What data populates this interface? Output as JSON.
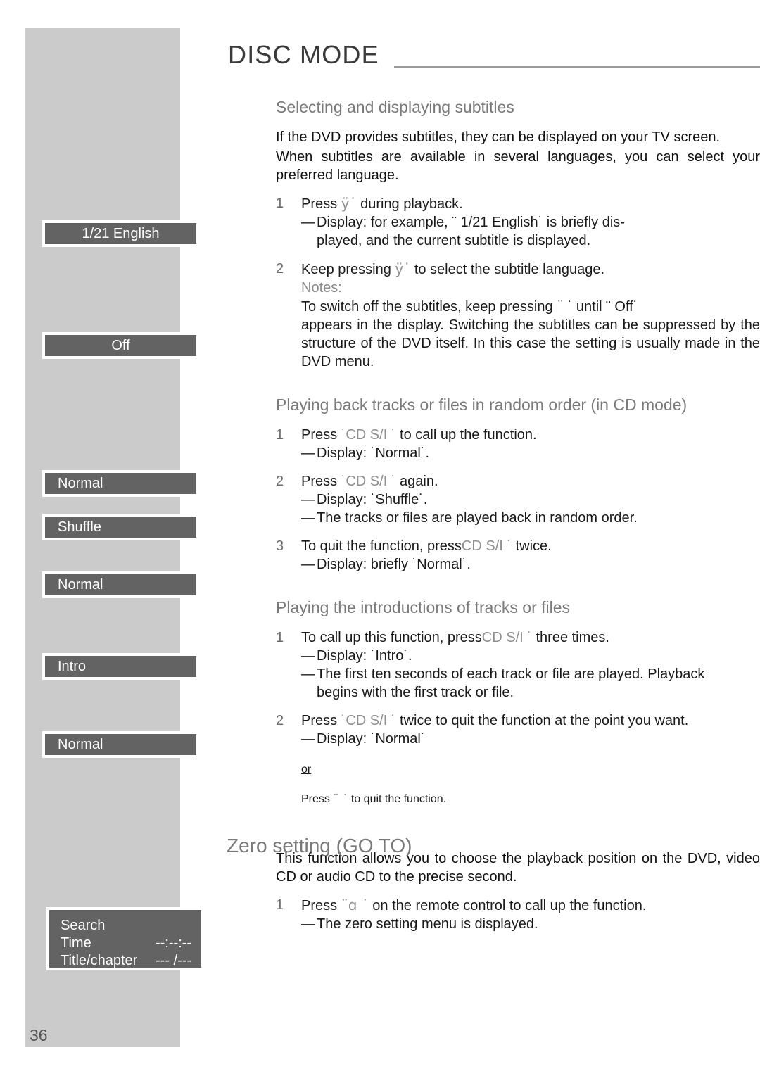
{
  "page": {
    "title": "DISC MODE",
    "number": "36"
  },
  "sidebar": {
    "boxes": [
      {
        "name": "subtitle-language",
        "label": "1/21  English"
      },
      {
        "name": "subtitle-off",
        "label": "Off"
      },
      {
        "name": "mode-normal-1",
        "label": "Normal"
      },
      {
        "name": "mode-shuffle",
        "label": "Shuffle"
      },
      {
        "name": "mode-normal-2",
        "label": "Normal"
      },
      {
        "name": "mode-intro",
        "label": "Intro"
      },
      {
        "name": "mode-normal-3",
        "label": "Normal"
      }
    ],
    "search_menu": {
      "title": "Search",
      "rows": [
        {
          "label": "Time",
          "value": "--:--:--"
        },
        {
          "label": "Title/chapter",
          "value": "--- /---"
        }
      ]
    }
  },
  "sections": {
    "subtitles": {
      "heading": "Selecting and displaying subtitles",
      "para1": "If the DVD provides subtitles, they can be displayed on your TV screen.",
      "para2": "When subtitles are available in several languages, you can select your preferred language.",
      "step1": {
        "num": "1",
        "line": "Press ÿ  ˙ during playback.",
        "press_prefix": "Press ",
        "key": "ÿ",
        "key_close": "˙",
        "suffix": " during playback.",
        "sub1_a": "Display:  for  example,  ¨     1/21  English˙  is  briefly  dis-",
        "sub1_b": "played, and the current subtitle is displayed."
      },
      "step2": {
        "num": "2",
        "press_prefix": "Keep pressing ",
        "key": "ÿ",
        "key_close": "˙",
        "suffix": " to select the subtitle language."
      },
      "notes_label": "Notes:",
      "notes_line1_a": "To switch off the subtitles, keep pressing ",
      "notes_line1_key": "¨",
      "notes_line1_b": " ˙ until ¨      Off˙",
      "notes_rest": "appears in the display. Switching the subtitles can be suppressed by the structure of the DVD itself. In this case the setting is usually made in the DVD menu."
    },
    "random": {
      "heading": "Playing back tracks or files in random order (in CD mode)",
      "step1": {
        "num": "1",
        "press_prefix": "Press ",
        "key": "˙CD S/I  ˙",
        "suffix": " to call up the function.",
        "sub": "Display: ˙Normal˙."
      },
      "step2": {
        "num": "2",
        "press_prefix": "Press ",
        "key": "˙CD S/I  ˙",
        "suffix": " again.",
        "sub1": "Display: ˙Shuffle˙.",
        "sub2": "The tracks or files are played back in random order."
      },
      "step3": {
        "num": "3",
        "press_prefix": "To quit the function, press",
        "key": "CD S/I  ˙",
        "suffix": " twice.",
        "sub": "Display: briefly ˙Normal˙."
      }
    },
    "intro": {
      "heading": "Playing the introductions of tracks or files",
      "step1": {
        "num": "1",
        "press_prefix": "To call up this function, press",
        "key": "CD S/I  ˙",
        "suffix": " three times.",
        "sub1": "Display: ˙Intro˙.",
        "sub2_a": "The first ten seconds of each track or file are played. Playback",
        "sub2_b": "begins with the first track or file."
      },
      "step2": {
        "num": "2",
        "press_prefix": "Press ",
        "key": "˙CD S/I  ˙",
        "suffix": " twice to quit the function at the point you want.",
        "sub": "Display: ˙Normal˙"
      },
      "or_word": "or",
      "quit_prefix": "Press ",
      "quit_key": "¨  ˙",
      "quit_suffix": " to quit the function."
    },
    "zero_setting": {
      "heading": "Zero setting (GO TO)",
      "para": "This function allows you to choose the playback position on the DVD, video CD or audio CD to the precise second.",
      "step1": {
        "num": "1",
        "press_prefix": "Press ",
        "key": "¨ɑ   ˙",
        "suffix": " on the remote control to call up the function.",
        "sub": "The zero setting menu is displayed."
      }
    }
  }
}
